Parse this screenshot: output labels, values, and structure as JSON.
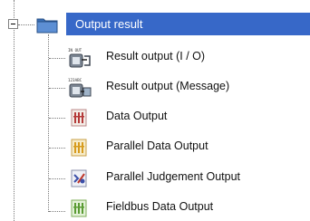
{
  "tree": {
    "root": {
      "label": "Output result",
      "expander_state": "expanded",
      "icon": "folder-icon",
      "selected": true,
      "highlight_color": "#3768c8"
    },
    "items": [
      {
        "label": "Result output (I / O)",
        "icon": "io-output-icon",
        "icon_text": "IN OUT"
      },
      {
        "label": "Result output (Message)",
        "icon": "message-output-icon",
        "icon_text": "123ABC"
      },
      {
        "label": "Data Output",
        "icon": "data-output-icon"
      },
      {
        "label": "Parallel Data Output",
        "icon": "parallel-data-output-icon"
      },
      {
        "label": "Parallel Judgement Output",
        "icon": "parallel-judgement-output-icon"
      },
      {
        "label": "Fieldbus Data Output",
        "icon": "fieldbus-data-output-icon"
      }
    ]
  }
}
